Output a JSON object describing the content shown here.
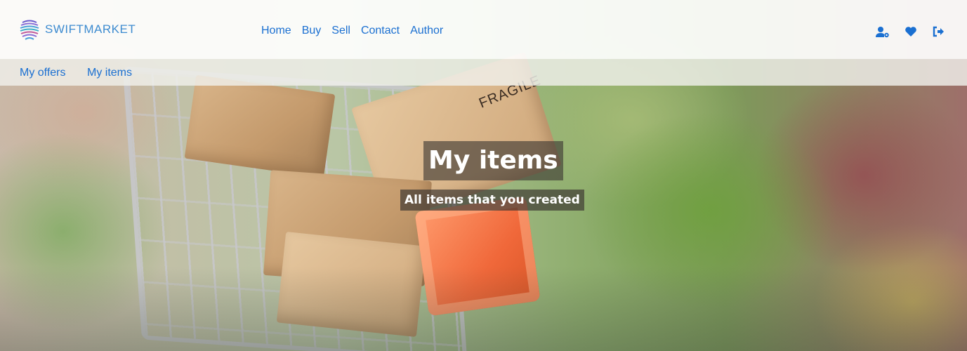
{
  "brand": {
    "name": "SWIFTMARKET",
    "logo_icon": "globe-lines-icon"
  },
  "nav": {
    "links": [
      "Home",
      "Buy",
      "Sell",
      "Contact",
      "Author"
    ],
    "icons": [
      "user-settings-icon",
      "heart-icon",
      "logout-icon"
    ]
  },
  "subnav": {
    "items": [
      "My offers",
      "My items"
    ]
  },
  "hero": {
    "title": "My items",
    "subtitle": "All items that you created",
    "box_print": "FRAGILE"
  },
  "colors": {
    "link": "#1a6fd1",
    "brand": "#3d8bd0",
    "hero_caption_bg": "#3c3732"
  }
}
